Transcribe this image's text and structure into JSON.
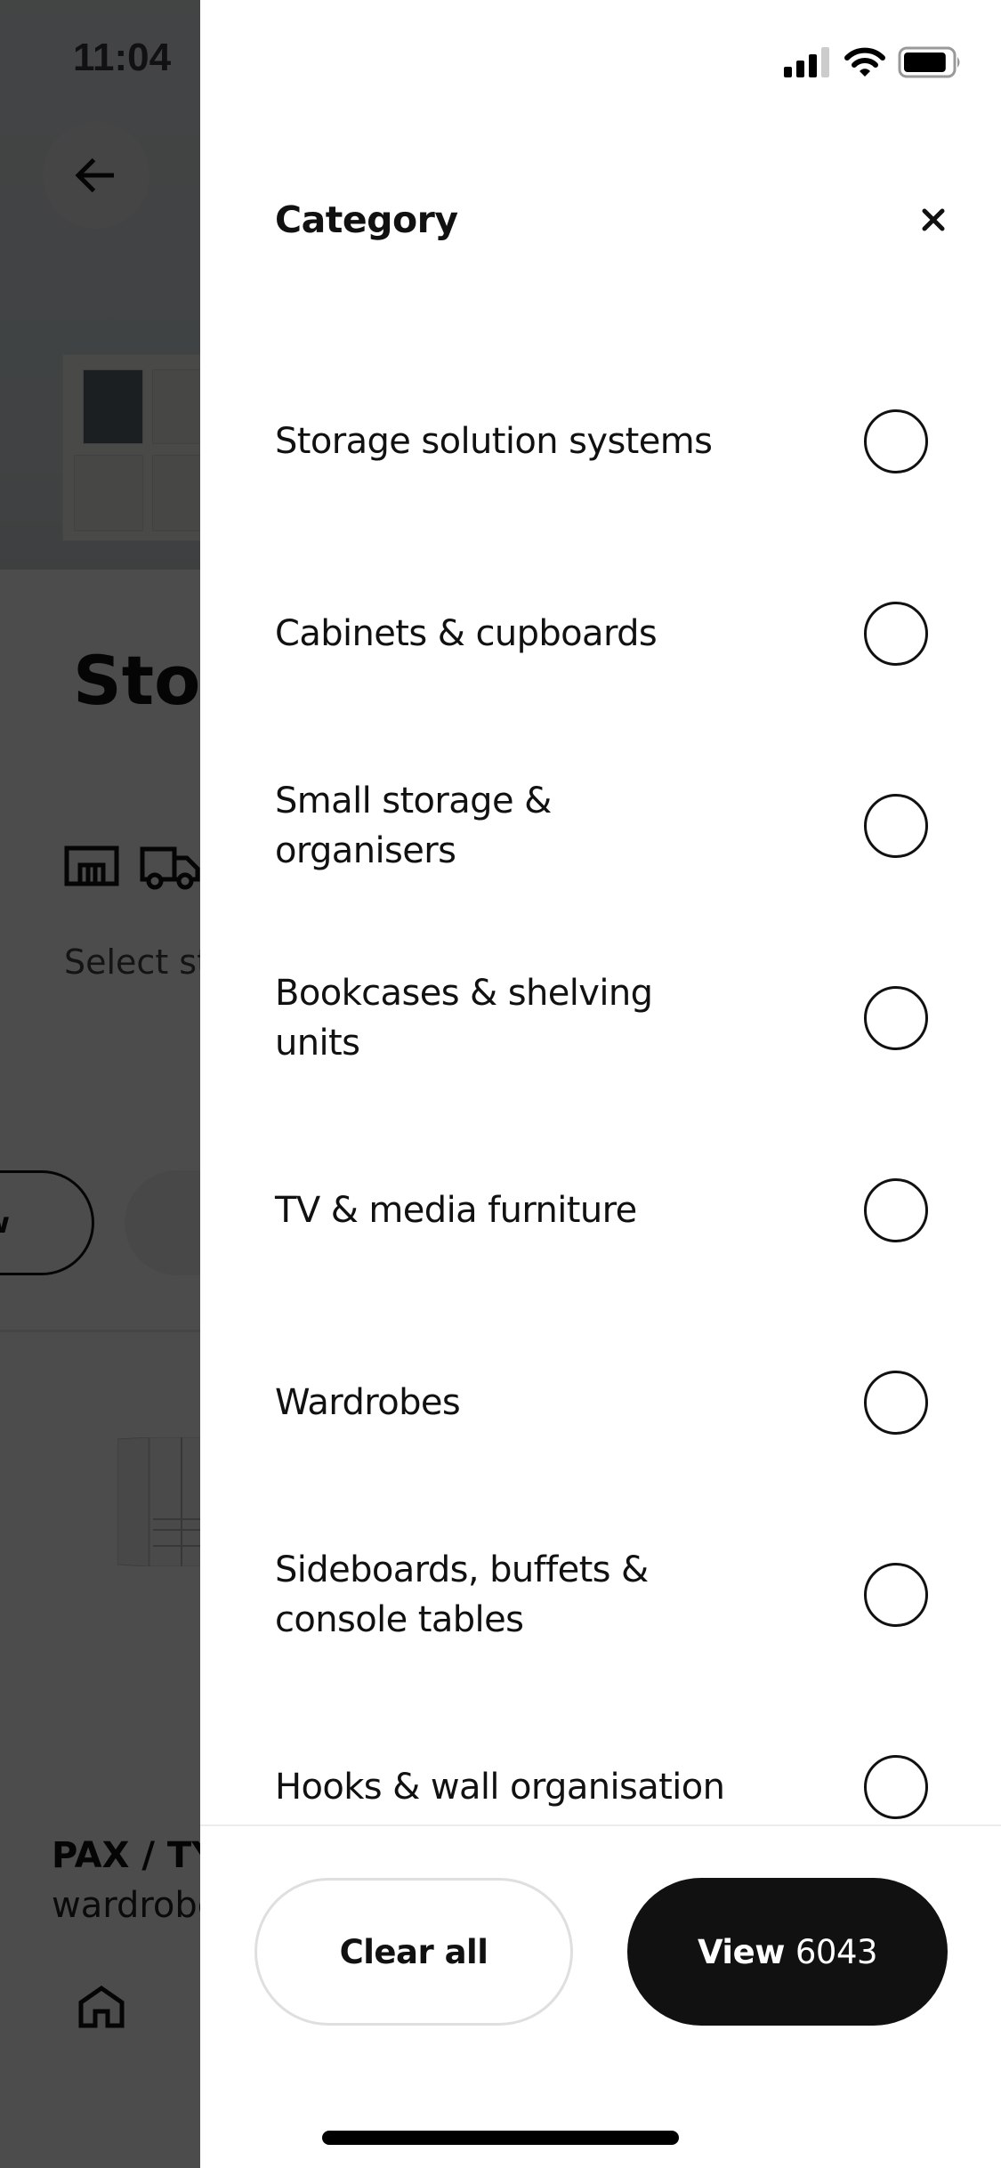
{
  "status_bar": {
    "time": "11:04",
    "signal_bars_filled": 3,
    "signal_bars_total": 4,
    "battery_level": 0.9
  },
  "background_page": {
    "back_icon": "arrow-left-icon",
    "title": "Storage & organisation",
    "availability_icons": [
      "store-icon",
      "delivery-truck-icon"
    ],
    "availability_text": "Select store or delivery to see what's in stock",
    "chip_partial_label": "Show",
    "product_name": "PAX / TYSSEDAL",
    "product_desc": "wardrobe",
    "home_icon": "home-icon"
  },
  "sheet": {
    "title": "Category",
    "close_icon": "close-icon",
    "items": [
      {
        "label": "Storage solution systems",
        "selected": false
      },
      {
        "label": "Cabinets & cupboards",
        "selected": false
      },
      {
        "label": "Small storage & organisers",
        "selected": false
      },
      {
        "label": "Bookcases & shelving units",
        "selected": false
      },
      {
        "label": "TV & media furniture",
        "selected": false
      },
      {
        "label": "Wardrobes",
        "selected": false
      },
      {
        "label": "Sideboards, buffets & console tables",
        "selected": false
      },
      {
        "label": "Hooks & wall organisation",
        "selected": false
      }
    ],
    "footer": {
      "clear_label": "Clear all",
      "view_label": "View",
      "view_count": "6043"
    }
  },
  "colors": {
    "primary": "#111111",
    "sheet_bg": "#ffffff",
    "scrim": "rgba(0,0,0,0.70)",
    "clear_border": "#dfdfdf"
  }
}
